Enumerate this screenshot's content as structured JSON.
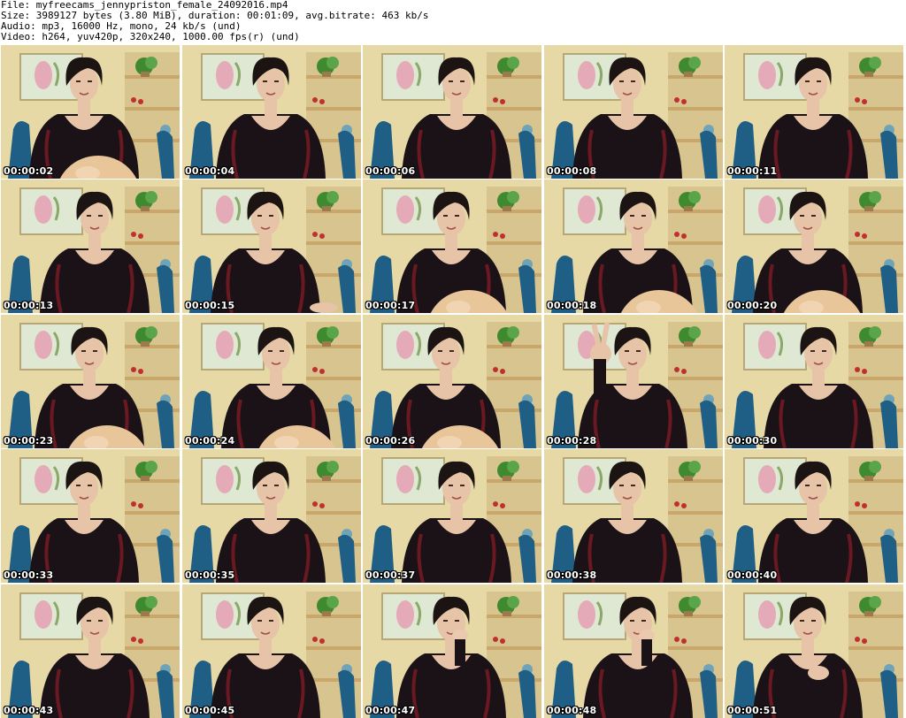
{
  "header": {
    "file": "File: myfreecams_jennypriston_female_24092016.mp4",
    "size": "Size: 3989127 bytes (3.80 MiB), duration: 00:01:09, avg.bitrate: 463 kb/s",
    "audio": "Audio: mp3, 16000 Hz, mono, 24 kb/s (und)",
    "video": "Video: h264, yuv420p, 320x240, 1000.00 fps(r) (und)"
  },
  "frames": [
    {
      "time": "00:00:02",
      "variant": "ball"
    },
    {
      "time": "00:00:04",
      "variant": "plain"
    },
    {
      "time": "00:00:06",
      "variant": "plain"
    },
    {
      "time": "00:00:08",
      "variant": "plain"
    },
    {
      "time": "00:00:11",
      "variant": "plain"
    },
    {
      "time": "00:00:13",
      "variant": "plain"
    },
    {
      "time": "00:00:15",
      "variant": "hand-low"
    },
    {
      "time": "00:00:17",
      "variant": "ball"
    },
    {
      "time": "00:00:18",
      "variant": "ball"
    },
    {
      "time": "00:00:20",
      "variant": "ball"
    },
    {
      "time": "00:00:23",
      "variant": "ball"
    },
    {
      "time": "00:00:24",
      "variant": "ball"
    },
    {
      "time": "00:00:26",
      "variant": "ball"
    },
    {
      "time": "00:00:28",
      "variant": "peace-sign"
    },
    {
      "time": "00:00:30",
      "variant": "plain"
    },
    {
      "time": "00:00:33",
      "variant": "plain"
    },
    {
      "time": "00:00:35",
      "variant": "plain"
    },
    {
      "time": "00:00:37",
      "variant": "plain"
    },
    {
      "time": "00:00:38",
      "variant": "plain"
    },
    {
      "time": "00:00:40",
      "variant": "plain"
    },
    {
      "time": "00:00:43",
      "variant": "plain"
    },
    {
      "time": "00:00:45",
      "variant": "plain"
    },
    {
      "time": "00:00:47",
      "variant": "hand-face"
    },
    {
      "time": "00:00:48",
      "variant": "hand-face"
    },
    {
      "time": "00:00:51",
      "variant": "hand-chest"
    }
  ],
  "colors": {
    "wall": "#e6d9a6",
    "picture": "#dfe8d2",
    "shelf": "#c9a76a",
    "plant": "#3f8a2f",
    "chair": "#1f5f86",
    "top": "#1a1216",
    "top_accent": "#6a1822",
    "skin": "#e7c3a8",
    "hair": "#1c1412",
    "ball": "#e9c59a"
  }
}
